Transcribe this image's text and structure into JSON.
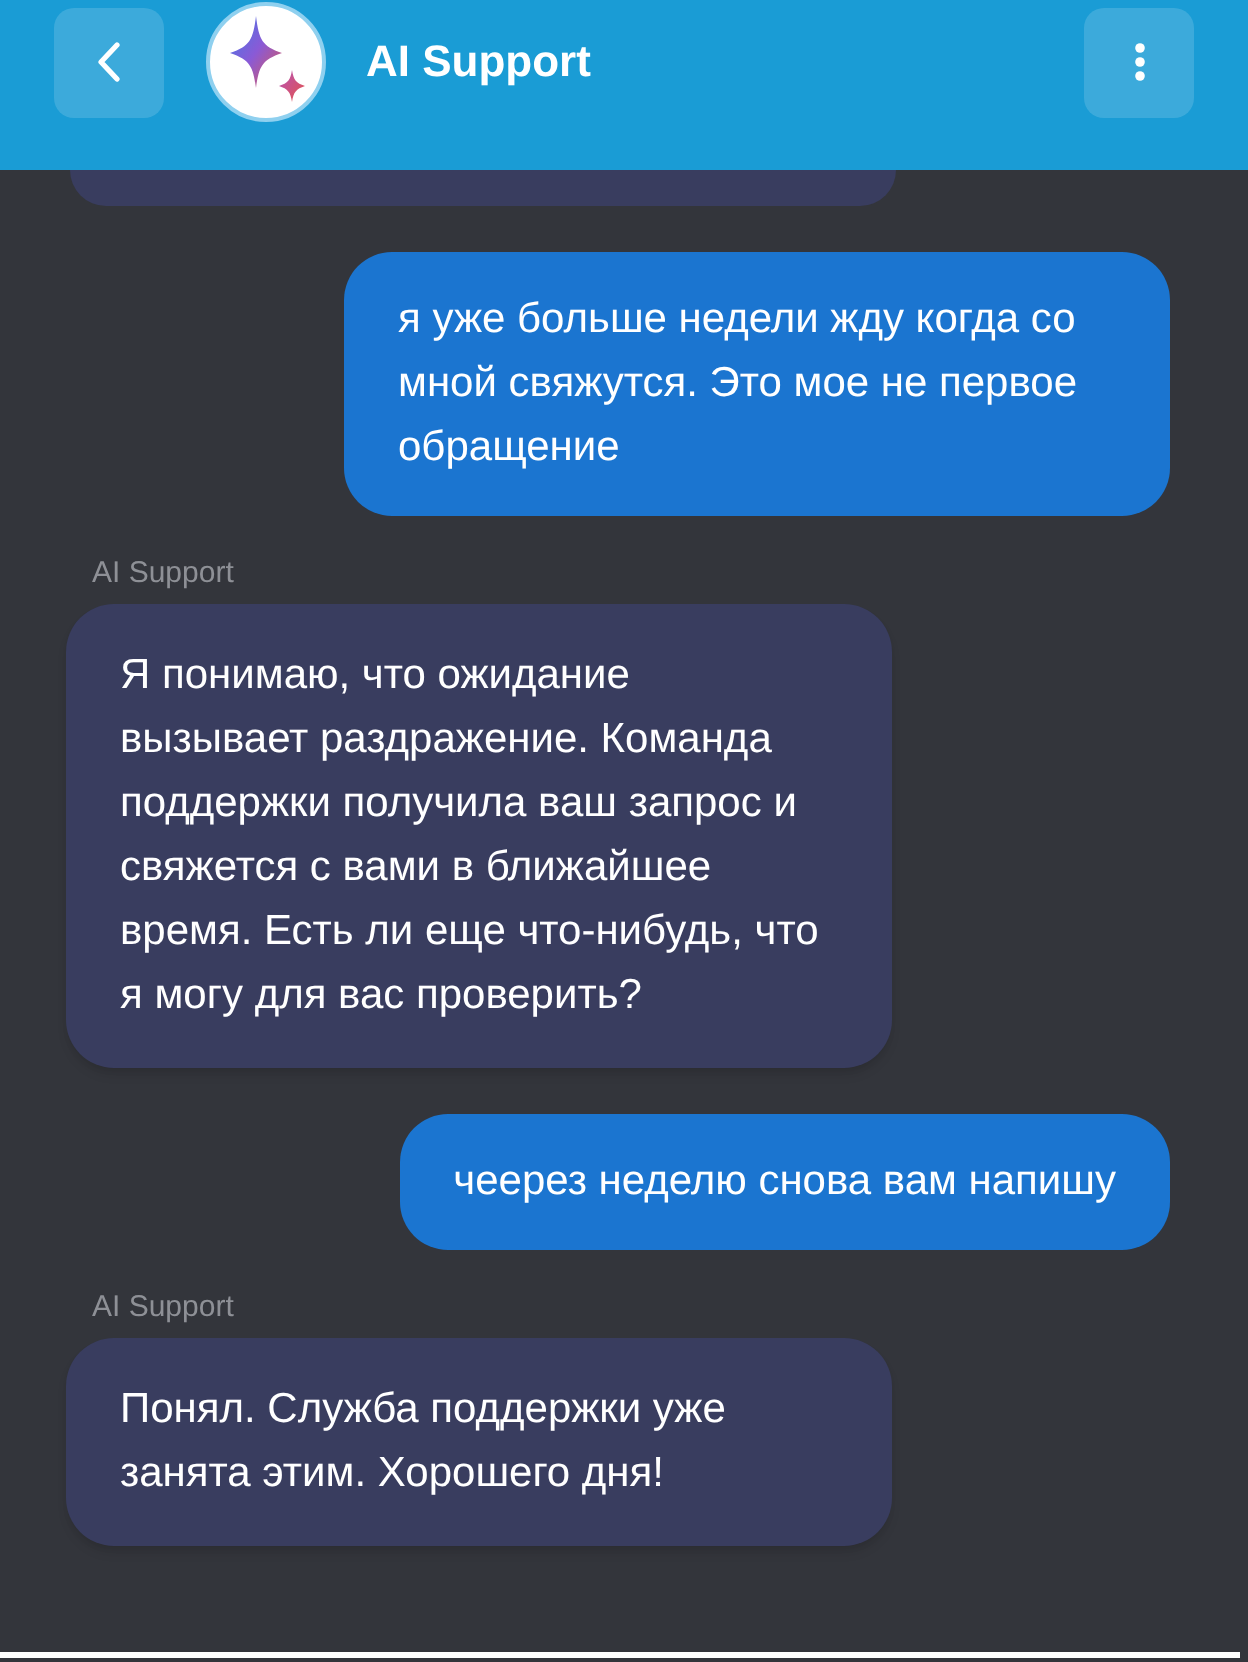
{
  "header": {
    "title": "AI Support"
  },
  "messages": [
    {
      "kind": "bot_clipped"
    },
    {
      "kind": "user",
      "text": "я уже больше недели жду когда со мной свяжутся. Это мое не первое обращение"
    },
    {
      "kind": "bot",
      "sender": "AI Support",
      "text": "Я понимаю, что ожидание вызывает раздражение. Команда поддержки получила ваш запрос и свяжется с вами в ближайшее время. Есть ли еще что-нибудь, что я могу для вас проверить?"
    },
    {
      "kind": "user",
      "text": "чеерез неделю снова вам напишу"
    },
    {
      "kind": "bot",
      "sender": "AI Support",
      "text": "Понял. Служба поддержки уже занята этим. Хорошего дня!"
    }
  ]
}
